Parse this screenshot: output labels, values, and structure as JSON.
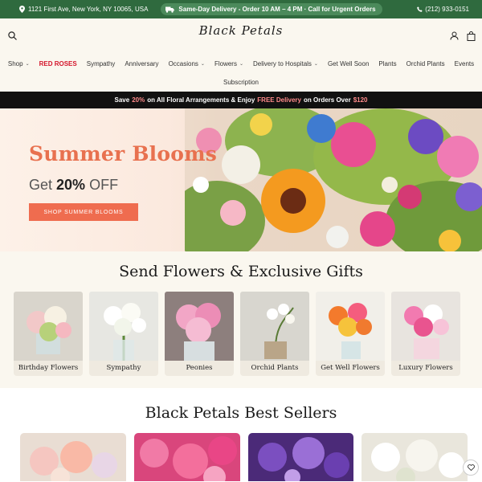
{
  "topbar": {
    "address": "1121 First Ave, New York, NY 10065, USA",
    "delivery": "Same-Day Delivery - Order 10 AM – 4 PM · Call for Urgent Orders",
    "phone": "(212) 933-0151"
  },
  "header": {
    "logo": "Black Petals",
    "icons": [
      "search-icon",
      "user-icon",
      "cart-icon"
    ]
  },
  "nav": {
    "row1": [
      {
        "label": "Shop",
        "dropdown": true
      },
      {
        "label": "RED ROSES",
        "dropdown": false,
        "highlight": true
      },
      {
        "label": "Sympathy",
        "dropdown": false
      },
      {
        "label": "Anniversary",
        "dropdown": false
      },
      {
        "label": "Occasions",
        "dropdown": true
      },
      {
        "label": "Flowers",
        "dropdown": true
      },
      {
        "label": "Delivery to Hospitals",
        "dropdown": true
      },
      {
        "label": "Get Well Soon",
        "dropdown": false
      },
      {
        "label": "Plants",
        "dropdown": false
      },
      {
        "label": "Orchid Plants",
        "dropdown": false
      },
      {
        "label": "Events",
        "dropdown": false
      }
    ],
    "row2": [
      {
        "label": "Subscription",
        "dropdown": false
      }
    ]
  },
  "promo": {
    "part1": "Save",
    "pct": "20%",
    "part2": "on All Floral Arrangements & Enjoy",
    "free": "FREE Delivery",
    "part3": "on Orders Over",
    "amount": "$120"
  },
  "hero": {
    "title": "Summer Blooms",
    "sub_pre": "Get",
    "sub_pct": "20%",
    "sub_post": "OFF",
    "button": "SHOP SUMMER BLOOMS"
  },
  "categories": {
    "title": "Send Flowers & Exclusive Gifts",
    "items": [
      {
        "label": "Birthday Flowers"
      },
      {
        "label": "Sympathy"
      },
      {
        "label": "Peonies"
      },
      {
        "label": "Orchid Plants"
      },
      {
        "label": "Get Well Flowers"
      },
      {
        "label": "Luxury Flowers"
      }
    ]
  },
  "best_sellers": {
    "title": "Black Petals Best Sellers"
  },
  "colors": {
    "topbar_green": "#2f6a3e",
    "accent_red": "#d4142a",
    "coral": "#ef6c4f",
    "cream": "#faf7ef"
  }
}
